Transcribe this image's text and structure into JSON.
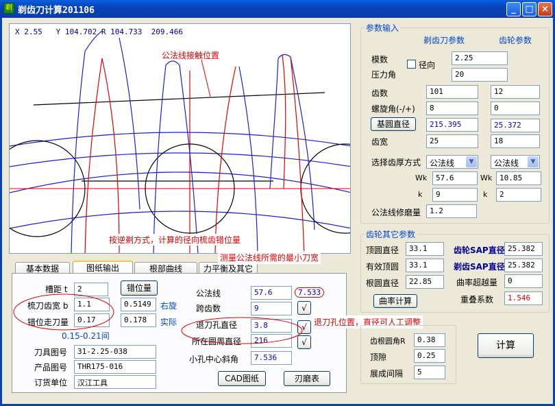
{
  "window": {
    "title": "剃齿刀计算201106",
    "icon": "app-icon",
    "controls": {
      "minimize": "_",
      "maximize": "□",
      "close": "×"
    }
  },
  "canvas": {
    "coord_text": "X 2.55   Y 104.702 R 104.733  209.466",
    "annotation_top": "公法线接触位置",
    "annotation_mid": "按逆剃方式，计算的径向梳齿错位量"
  },
  "tabs": [
    {
      "label": "基本数据"
    },
    {
      "label": "图纸输出"
    },
    {
      "label": "根部曲线"
    },
    {
      "label": "力平衡及其它"
    }
  ],
  "tooltips": {
    "min_width": "测量公法线所需的最小刀宽",
    "relief": "退刀孔位置，直径可人工调整"
  },
  "drawing_tab": {
    "slot_pitch": {
      "label": "槽距 t",
      "value": "2"
    },
    "misalign_btn": "错位量",
    "comb_width": {
      "label": "梳刀齿宽 b",
      "value": "1.1",
      "value2": "0.5149",
      "side": "右旋"
    },
    "misalign_walk": {
      "label": "错位走刀量",
      "value": "0.17",
      "value2": "0.178",
      "note": "实际"
    },
    "range_note": "0.15-0.21间",
    "tool_no": {
      "label": "刀具图号",
      "value": "31-2.25-038"
    },
    "product_no": {
      "label": "产品图号",
      "value": "THR175-016"
    },
    "order_unit": {
      "label": "订货单位",
      "value": "汉江工具"
    },
    "common_normal": {
      "label": "公法线",
      "value": "57.6",
      "extra": "7.533"
    },
    "span_teeth": {
      "label": "跨齿数",
      "value": "9"
    },
    "relief_dia": {
      "label": "退刀孔直径",
      "value": "3.8"
    },
    "circle_dia": {
      "label": "所在圆周直径",
      "value": "216"
    },
    "hole_angle": {
      "label": "小孔中心斜角",
      "value": "7.536"
    },
    "check_mark": "√",
    "cad_btn": "CAD图纸",
    "grind_btn": "刃磨表"
  },
  "params": {
    "group_title": "参数输入",
    "col_cutter": "剃齿刀参数",
    "col_gear": "齿轮参数",
    "module": {
      "label": "模数",
      "value": "2.25"
    },
    "radial": {
      "label": "径向"
    },
    "pressure_angle": {
      "label": "压力角",
      "value": "20"
    },
    "teeth": {
      "label": "齿数",
      "cutter": "101",
      "gear": "12"
    },
    "helix": {
      "label": "螺旋角(-/+)",
      "cutter": "8",
      "gear": "0"
    },
    "base_dia": {
      "label": "基圆直径",
      "cutter": "215.395",
      "gear": "25.372"
    },
    "face_width": {
      "label": "齿宽",
      "cutter": "25",
      "gear": "18"
    },
    "thickness_mode": {
      "label": "选择齿厚方式",
      "cutter": "公法线",
      "gear": "公法线"
    },
    "wk": {
      "label": "Wk",
      "cutter": "57.6",
      "gear": "10.85"
    },
    "k": {
      "label": "k",
      "cutter": "9",
      "gear": "2"
    },
    "grind_amount": {
      "label": "公法线修磨量",
      "value": "1.2"
    }
  },
  "gear_other": {
    "group_title": "齿轮其它参数",
    "tip_dia": {
      "label": "顶圆直径",
      "value": "33.1"
    },
    "eff_tip": {
      "label": "有效顶圆",
      "value": "33.1"
    },
    "root_dia": {
      "label": "根圆直径",
      "value": "22.85"
    },
    "sap_gear": {
      "label": "齿轮SAP直径",
      "value": "25.382"
    },
    "sap_shave": {
      "label": "剃齿SAP直径",
      "value": "25.382"
    },
    "overcut": {
      "label": "曲率超越量",
      "value": "0"
    },
    "curvature_btn": "曲率计算",
    "overlap": {
      "label": "重叠系数",
      "value": "1.546"
    }
  },
  "bottom_right": {
    "root_radius": {
      "label": "齿根圆角R",
      "value": "0.38"
    },
    "clearance": {
      "label": "顶隙",
      "value": "0.25"
    },
    "spread": {
      "label": "展成间隔",
      "value": "5"
    },
    "calc_btn": "计算"
  },
  "colors": {
    "accent": "#0046d5",
    "red": "#e00000",
    "titlebar": "#0842b8"
  }
}
